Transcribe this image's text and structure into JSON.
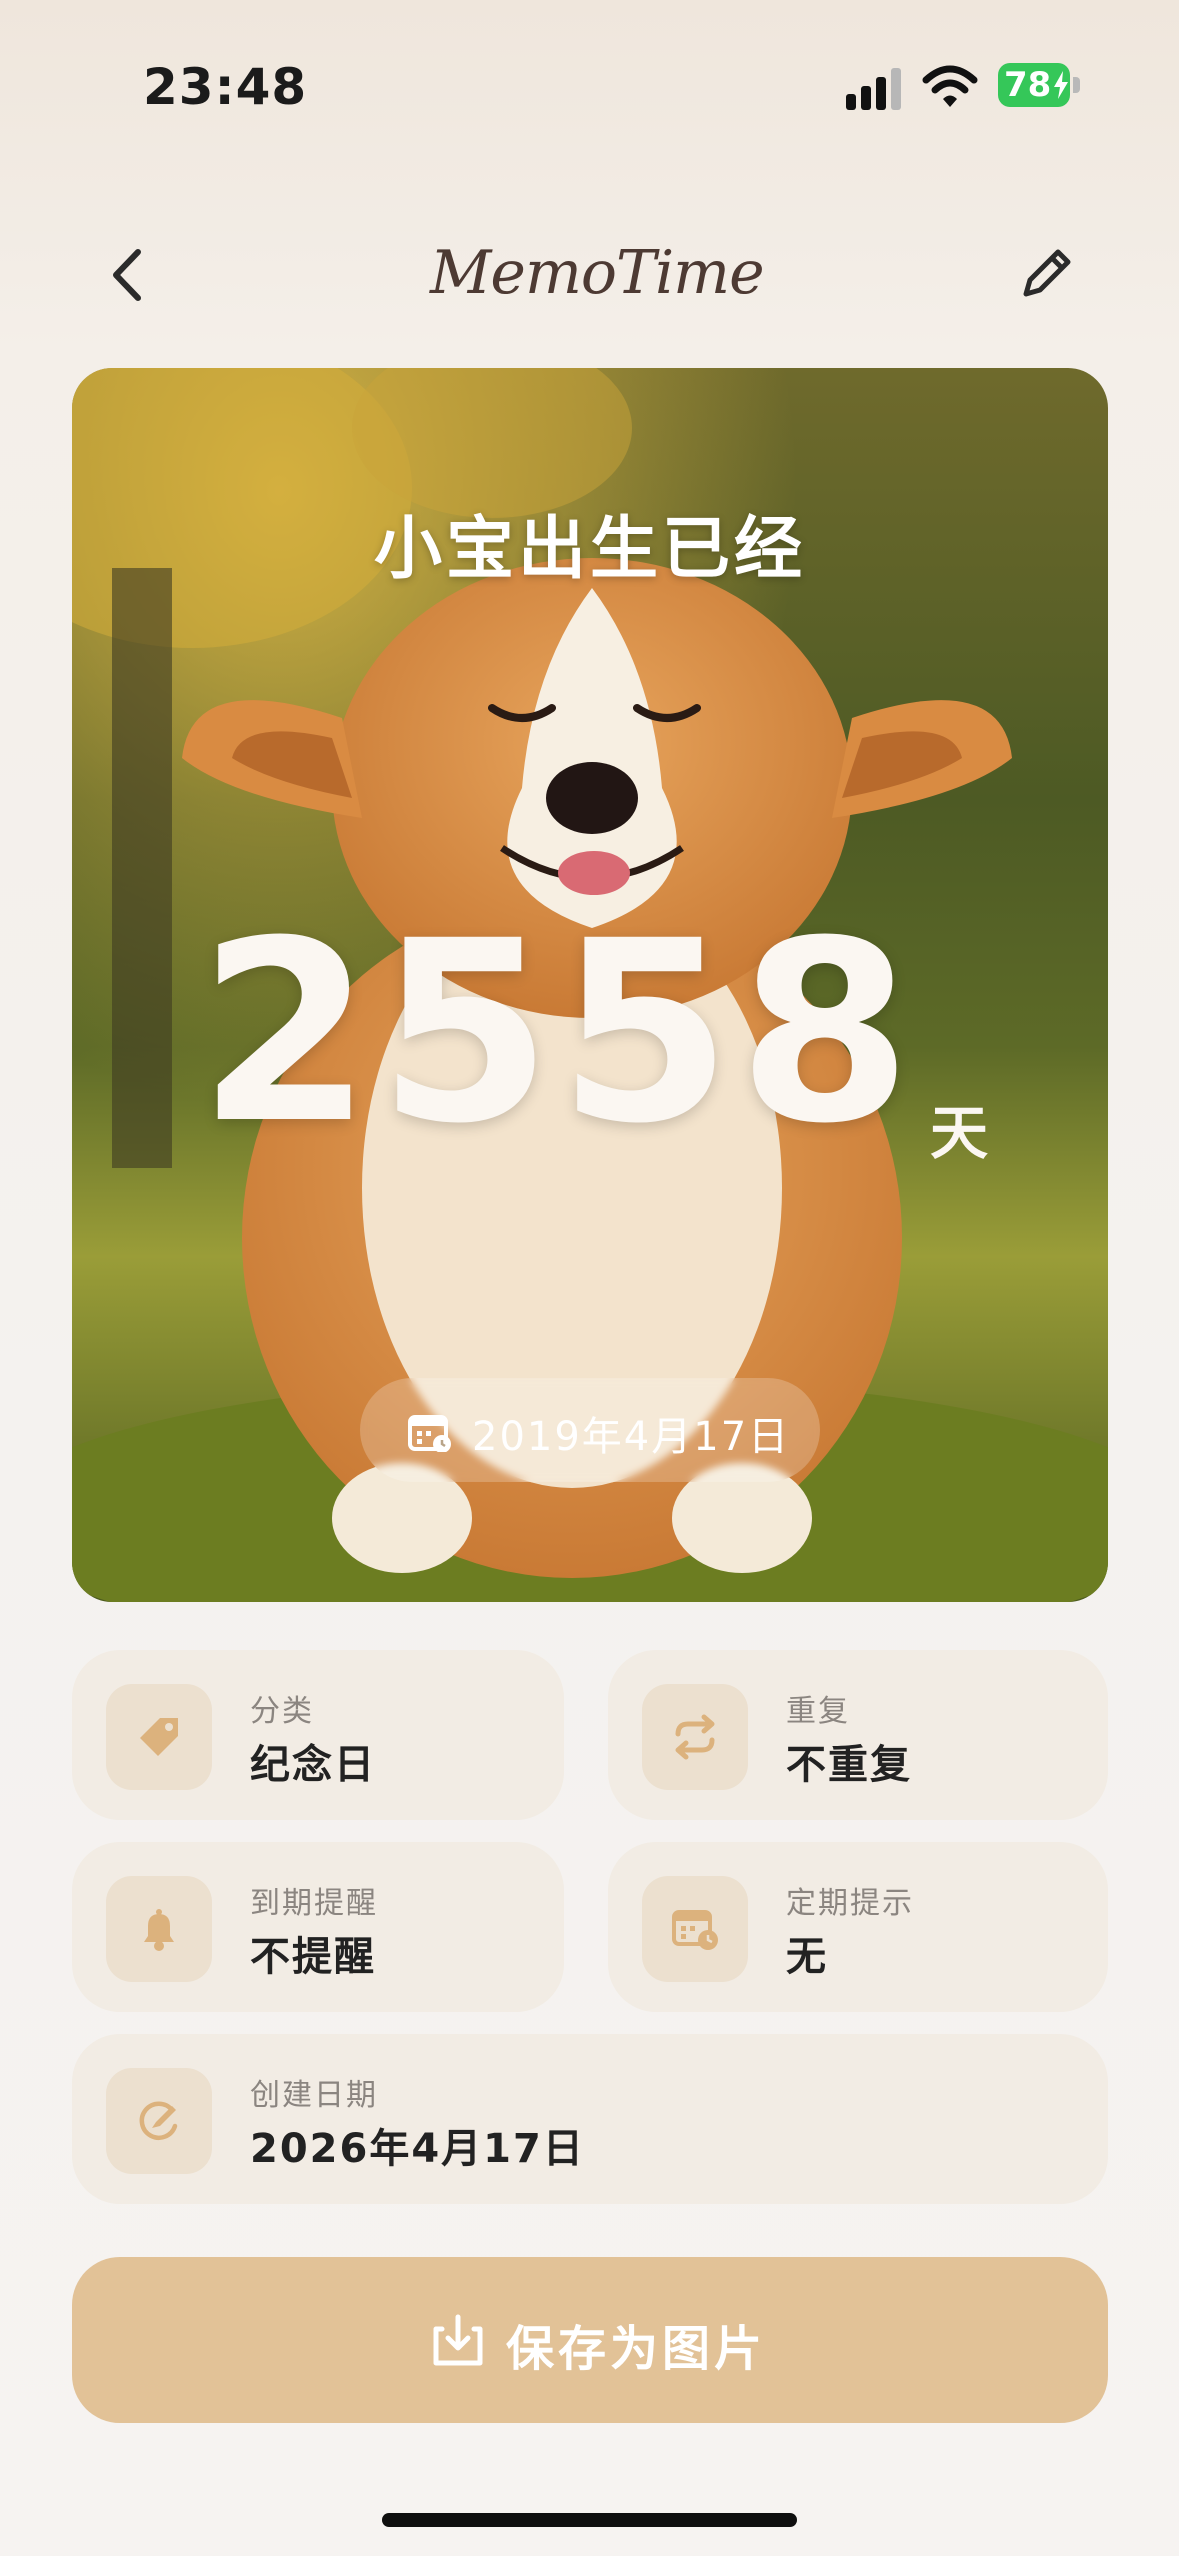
{
  "status_bar": {
    "time": "23:48",
    "battery": "78",
    "icons": [
      "signal-icon",
      "wifi-icon",
      "battery-icon"
    ]
  },
  "header": {
    "logo_text": "MemoTime",
    "back_icon": "chevron-left-icon",
    "edit_icon": "pencil-icon"
  },
  "hero": {
    "title": "小宝出生已经",
    "count": "2558",
    "unit": "天",
    "date": "2019年4月17日",
    "date_icon": "calendar-icon",
    "photo_description": "corgi-dog-photo"
  },
  "details": [
    {
      "label": "分类",
      "value": "纪念日",
      "icon": "tag-icon"
    },
    {
      "label": "重复",
      "value": "不重复",
      "icon": "repeat-icon"
    },
    {
      "label": "到期提醒",
      "value": "不提醒",
      "icon": "bell-icon"
    },
    {
      "label": "定期提示",
      "value": "无",
      "icon": "calendar-clock-icon"
    },
    {
      "label": "创建日期",
      "value": "2026年4月17日",
      "icon": "created-icon"
    }
  ],
  "save_button": {
    "label": "保存为图片",
    "icon": "download-icon"
  },
  "colors": {
    "accent": "#e2c297",
    "icon_tint": "#d9b07e",
    "card_bg": "#f2ece4",
    "battery_green": "#35c759"
  }
}
